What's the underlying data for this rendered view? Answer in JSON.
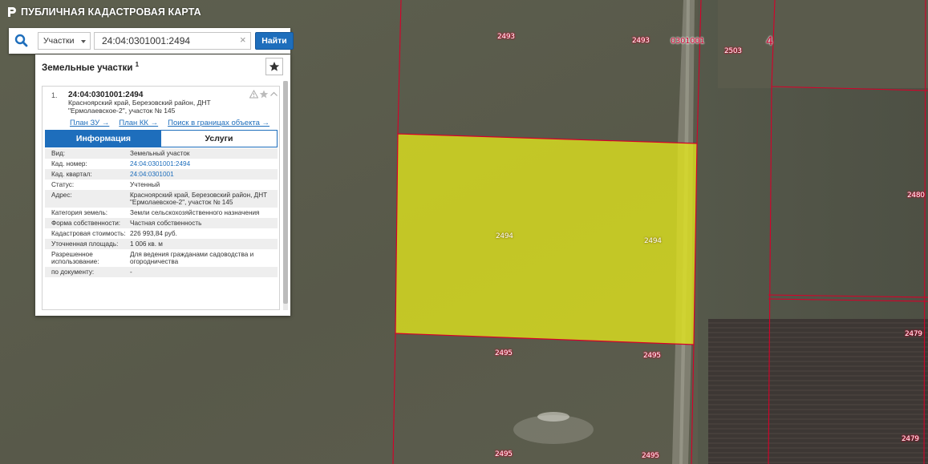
{
  "app": {
    "title": "ПУБЛИЧНАЯ КАДАСТРОВАЯ КАРТА"
  },
  "search": {
    "type_select": "Участки",
    "value": "24:04:0301001:2494",
    "button": "Найти"
  },
  "results": {
    "heading": "Земельные участки",
    "count": "1",
    "item": {
      "number": "1.",
      "cad_number": "24:04:0301001:2494",
      "address_line1": "Красноярский край, Березовский район, ДНТ",
      "address_line2": "\"Ермолаевское-2\", участок № 145"
    },
    "links": [
      "План ЗУ →",
      "План КК →",
      "Поиск в границах объекта →"
    ],
    "tabs": [
      "Информация",
      "Услуги"
    ],
    "info": [
      {
        "k": "Вид:",
        "v": "Земельный участок"
      },
      {
        "k": "Кад. номер:",
        "v": "24:04:0301001:2494"
      },
      {
        "k": "Кад. квартал:",
        "v": "24:04:0301001"
      },
      {
        "k": "Статус:",
        "v": "Учтенный"
      },
      {
        "k": "Адрес:",
        "v": "Красноярский край, Березовский район, ДНТ \"Ермолаевское-2\", участок № 145"
      },
      {
        "k": "Категория земель:",
        "v": "Земли сельскохозяйственного назначения"
      },
      {
        "k": "Форма собственности:",
        "v": "Частная собственность"
      },
      {
        "k": "Кадастровая стоимость:",
        "v": "226 993,84 руб."
      },
      {
        "k": "Уточненная площадь:",
        "v": "1 006 кв. м"
      },
      {
        "k": "Разрешенное использование:",
        "v": "Для ведения гражданами садоводства и огородничества"
      },
      {
        "k": "по документу:",
        "v": "-"
      }
    ]
  },
  "map": {
    "labels": {
      "l1": "2493",
      "l2": "2493",
      "l3": "0301001",
      "l4": "2503",
      "l5": "4",
      "l6": "2494",
      "l7": "2494",
      "l8": "2480",
      "l9": "2479",
      "l10": "2479",
      "l11": "2495",
      "l12": "2495",
      "l13": "2495",
      "l14": "2495"
    },
    "colors": {
      "boundary": "#d6002a",
      "selected_fill": "#e8ea1a"
    }
  }
}
